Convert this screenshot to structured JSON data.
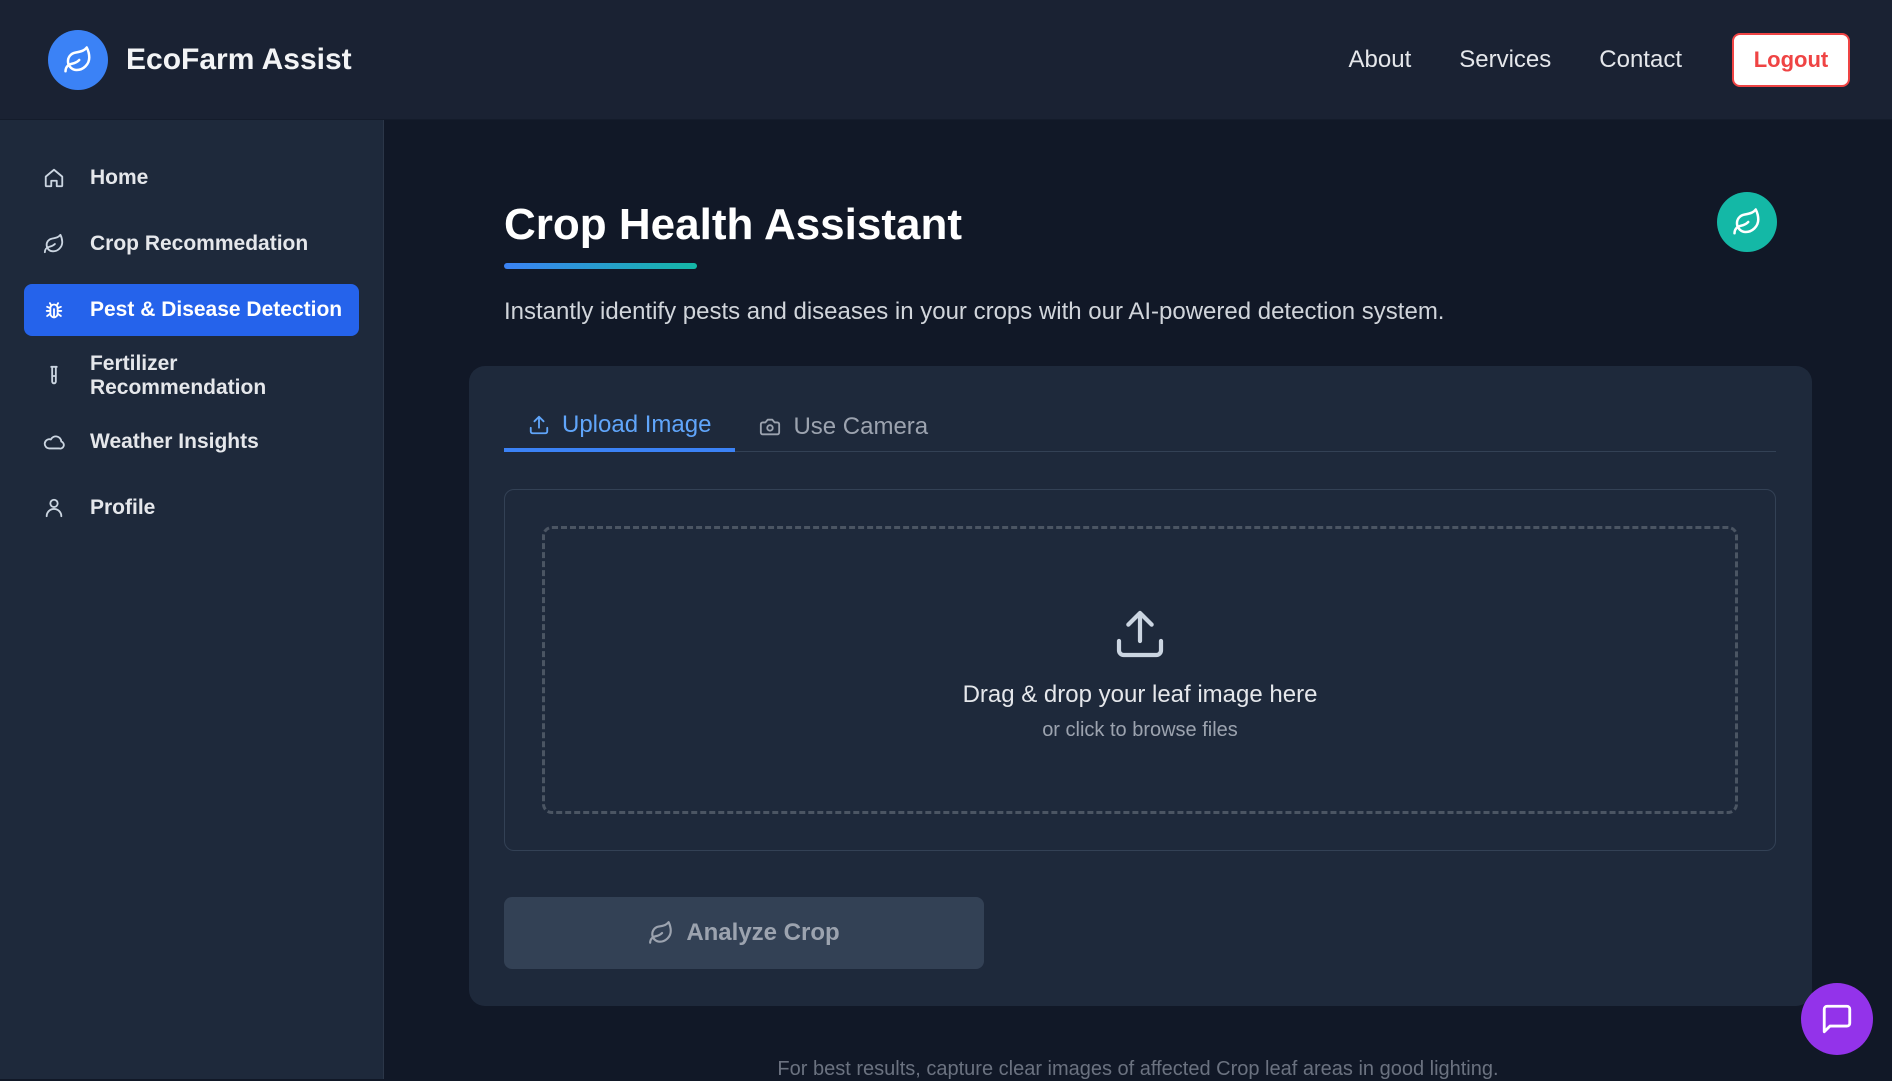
{
  "header": {
    "brand_name": "EcoFarm Assist",
    "brand_icon": "leaf-icon",
    "nav": [
      {
        "label": "About"
      },
      {
        "label": "Services"
      },
      {
        "label": "Contact"
      }
    ],
    "logout_label": "Logout"
  },
  "sidebar": {
    "items": [
      {
        "label": "Home",
        "icon": "home-icon",
        "active": false
      },
      {
        "label": "Crop Recommedation",
        "icon": "leaf-icon",
        "active": false
      },
      {
        "label": "Pest & Disease Detection",
        "icon": "bug-icon",
        "active": true
      },
      {
        "label": "Fertilizer Recommendation",
        "icon": "test-tube-icon",
        "active": false
      },
      {
        "label": "Weather Insights",
        "icon": "cloud-icon",
        "active": false
      },
      {
        "label": "Profile",
        "icon": "user-icon",
        "active": false
      }
    ]
  },
  "main": {
    "title": "Crop Health Assistant",
    "subtitle": "Instantly identify pests and diseases in your crops with our AI-powered detection system.",
    "tabs": [
      {
        "label": "Upload Image",
        "icon": "upload-icon",
        "active": true
      },
      {
        "label": "Use Camera",
        "icon": "camera-icon",
        "active": false
      }
    ],
    "dropzone": {
      "title": "Drag & drop your leaf image here",
      "subtitle": "or click to browse files"
    },
    "analyze_label": "Analyze Crop",
    "footer_note": "For best results, capture clear images of affected Crop leaf areas in good lighting."
  },
  "colors": {
    "accent": "#2563eb",
    "teal": "#14b8a6",
    "danger": "#ef4444",
    "chat": "#9333ea"
  }
}
